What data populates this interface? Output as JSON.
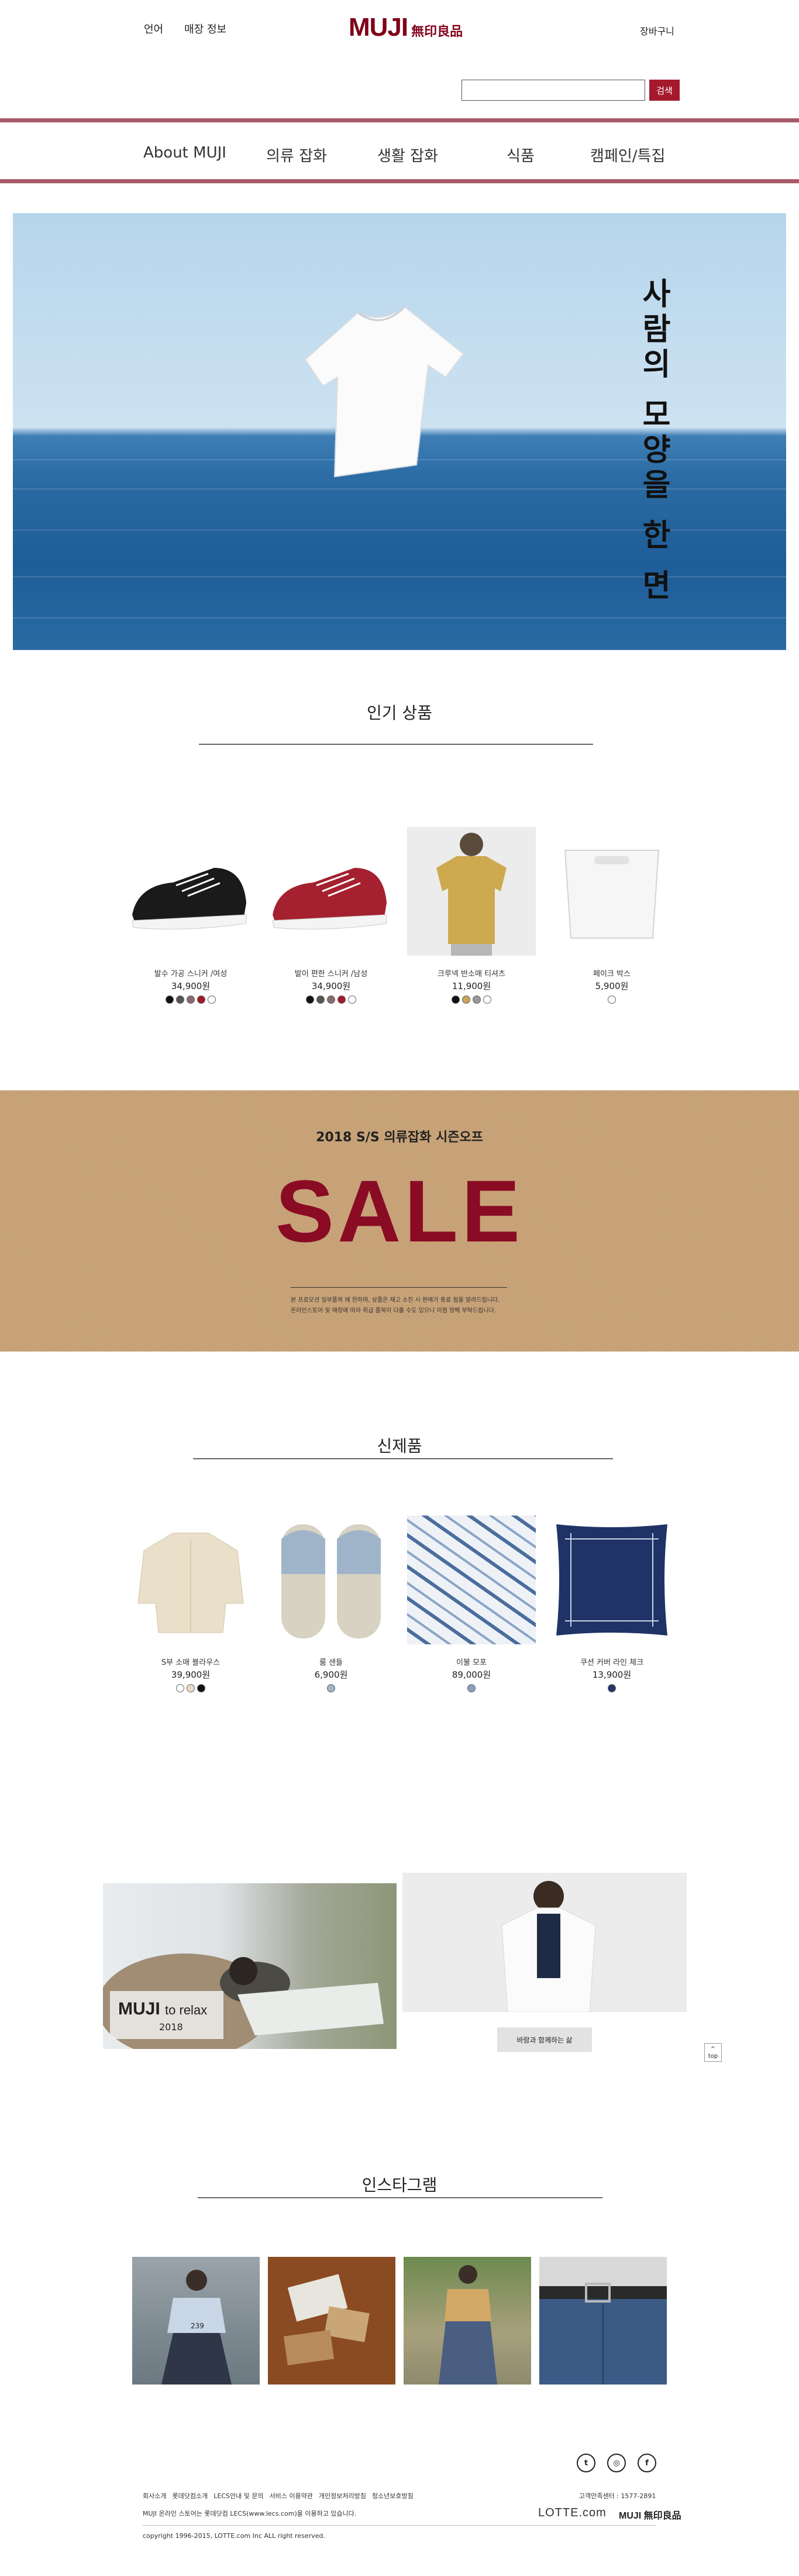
{
  "header": {
    "language": "언어",
    "store_info": "매장 정보",
    "logo_en": "MUJI",
    "logo_kr": "無印良品",
    "cart": "장바구니",
    "search_placeholder": "",
    "search_button": "검색",
    "accent_color": "#a41a2c"
  },
  "nav": [
    "About MUJI",
    "의류 잡화",
    "생활 잡화",
    "식품",
    "캠페인/특집"
  ],
  "hero": {
    "text": "사람의 모양을 한 면"
  },
  "popular": {
    "title": "인기 상품",
    "items": [
      {
        "name": "발수 가공 스니커 /여성",
        "price": "34,900원",
        "swatches": [
          "#111111",
          "#555555",
          "#8a6a6a",
          "#a01a2a",
          "#ffffff"
        ]
      },
      {
        "name": "발이 편한 스니커 /남성",
        "price": "34,900원",
        "swatches": [
          "#111111",
          "#555555",
          "#8a6a6a",
          "#a01a2a",
          "#ffffff"
        ]
      },
      {
        "name": "크루넥 반소매 티셔츠",
        "price": "11,900원",
        "swatches": [
          "#111111",
          "#c9a35a",
          "#999999",
          "#ffffff"
        ]
      },
      {
        "name": "페이크 박스",
        "price": "5,900원",
        "swatches": [
          "#ffffff"
        ]
      }
    ]
  },
  "sale": {
    "subtitle": "2018 S/S 의류잡화 시즌오프",
    "big": "SALE",
    "desc1": "본 프로모션 일부품목 에 한하며, 상품은 재고 소진 시 판매가 종료 됨을 알려드립니다.",
    "desc2": "온라인스토어 및 매장에 따라 취급 품목이 다를 수도 있으니 이점 양해 부탁드립니다."
  },
  "new": {
    "title": "신제품",
    "items": [
      {
        "name": "S부 소매 블라우스",
        "price": "39,900원",
        "swatches": [
          "#ffffff",
          "#e8dcc6",
          "#111111"
        ]
      },
      {
        "name": "룸 샌들",
        "price": "6,900원",
        "swatches": [
          "#9fb4c8"
        ]
      },
      {
        "name": "이불 모포",
        "price": "89,000원",
        "swatches": [
          "#8a9fc0"
        ]
      },
      {
        "name": "쿠션 커버 라인 체크",
        "price": "13,900원",
        "swatches": [
          "#23356a"
        ]
      }
    ]
  },
  "promo": {
    "brand": "MUJI",
    "tagline": "to relax",
    "year": "2018",
    "button": "바람과 함께하는 삶",
    "top": "top"
  },
  "instagram": {
    "title": "인스타그램",
    "count": "239"
  },
  "footer": {
    "links": [
      "회사소개",
      "롯데닷컴소개",
      "LECS안내 및 문의",
      "서비스 이용약관",
      "개인정보처리방침",
      "청소년보호방침"
    ],
    "cs": "고객만족센터 : 1577-2891",
    "desc": "MUJI 온라인 스토어는 롯데닷컴 LECS(www.lecs.com)을 이용하고 있습니다.",
    "lotte": "LOTTE.com",
    "muji": "MUJI 無印良品",
    "copyright": "copyright 1996-2015, LOTTE.com Inc ALL right reserved.",
    "social": [
      "twitter-icon",
      "instagram-icon",
      "facebook-icon"
    ]
  }
}
